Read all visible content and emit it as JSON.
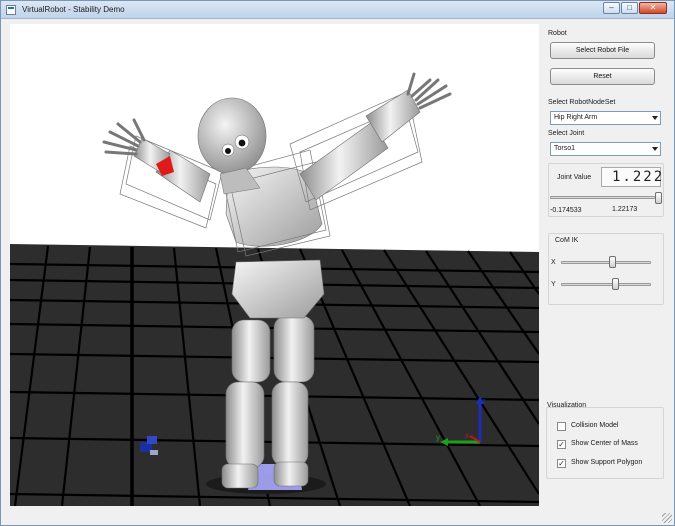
{
  "window": {
    "title": "VirtualRobot - Stability Demo",
    "controls": {
      "minimize": "–",
      "maximize": "□",
      "close": "✕"
    }
  },
  "panel": {
    "robot_group": {
      "title": "Robot",
      "select_file_button": "Select Robot File",
      "reset_button": "Reset",
      "node_set_label": "Select RobotNodeSet",
      "node_set_value": "Hip Right Arm",
      "joint_label": "Select Joint",
      "joint_value": "Torso1",
      "joint_value_label": "Joint Value",
      "joint_value_display": "1.222",
      "joint_slider_position": 1.0,
      "joint_min": "-0.174533",
      "joint_max": "1.22173"
    },
    "com_ik_group": {
      "title": "CoM IK",
      "x_label": "X",
      "y_label": "Y",
      "x_slider_position": 0.58,
      "y_slider_position": 0.62
    },
    "visualization_group": {
      "title": "Visualization",
      "options": [
        {
          "label": "Collision Model",
          "checked": false
        },
        {
          "label": "Show Center of Mass",
          "checked": true
        },
        {
          "label": "Show Support Polygon",
          "checked": true
        }
      ]
    }
  },
  "viewport": {
    "axes_labels": {
      "x": "x",
      "y": "y",
      "z": "z"
    },
    "colors": {
      "background": "#ffffff",
      "floor": "#2d2d2d",
      "grid": "#000000",
      "support_polygon": "#aaaaff",
      "com_marker": "#1c2fa0",
      "collision_box": "#777777",
      "robot": "#cfcfcf"
    }
  }
}
